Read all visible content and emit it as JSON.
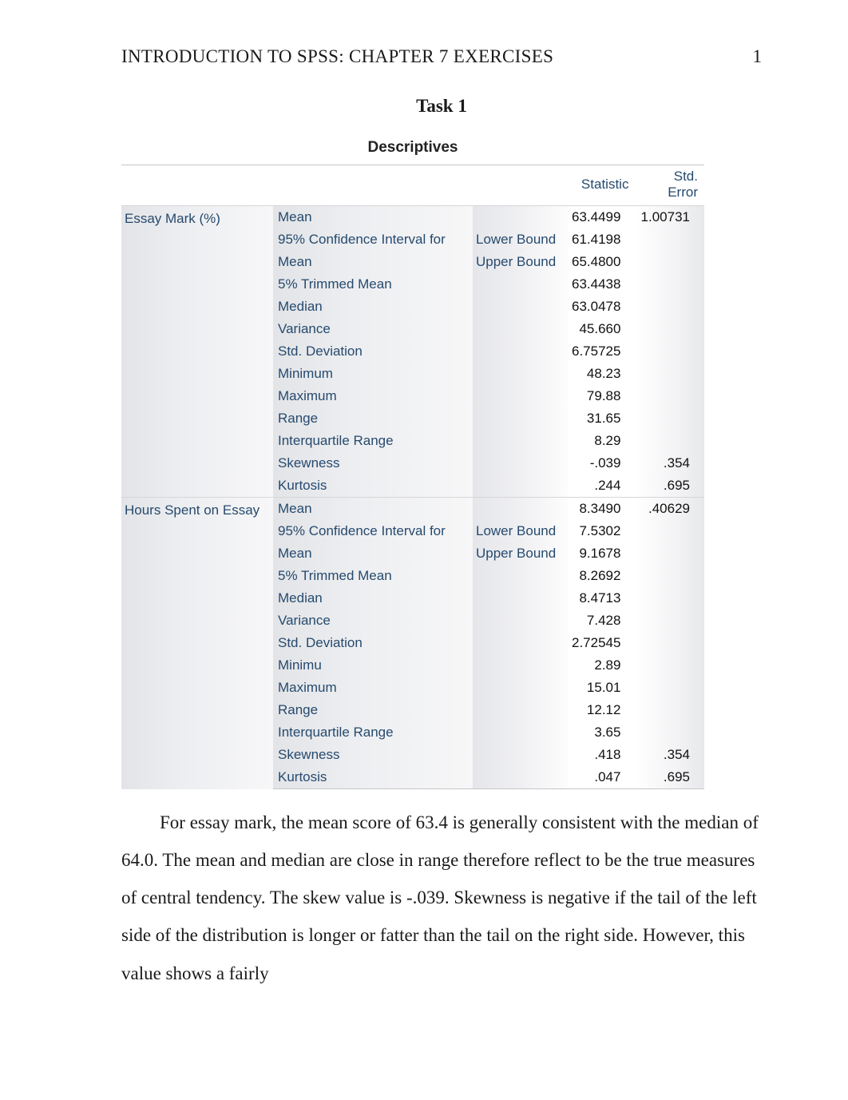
{
  "header": {
    "running_head": "INTRODUCTION TO SPSS: CHAPTER 7 EXERCISES",
    "page_number": "1"
  },
  "task_title": "Task 1",
  "table": {
    "title": "Descriptives",
    "col_statistic": "Statistic",
    "col_stderror": "Std. Error",
    "groups": [
      {
        "variable": "Essay Mark (%)",
        "rows": [
          {
            "label": "Mean",
            "bound": "",
            "stat": "63.4499",
            "se": "1.00731"
          },
          {
            "label": "95% Confidence Interval for",
            "bound": "Lower Bound",
            "stat": "61.4198",
            "se": ""
          },
          {
            "label": "Mean",
            "bound": "Upper Bound",
            "stat": "65.4800",
            "se": ""
          },
          {
            "label": "5% Trimmed Mean",
            "bound": "",
            "stat": "63.4438",
            "se": ""
          },
          {
            "label": "Median",
            "bound": "",
            "stat": "63.0478",
            "se": ""
          },
          {
            "label": "Variance",
            "bound": "",
            "stat": "45.660",
            "se": ""
          },
          {
            "label": "Std. Deviation",
            "bound": "",
            "stat": "6.75725",
            "se": ""
          },
          {
            "label": "Minimum",
            "bound": "",
            "stat": "48.23",
            "se": ""
          },
          {
            "label": "Maximum",
            "bound": "",
            "stat": "79.88",
            "se": ""
          },
          {
            "label": "Range",
            "bound": "",
            "stat": "31.65",
            "se": ""
          },
          {
            "label": "Interquartile Range",
            "bound": "",
            "stat": "8.29",
            "se": ""
          },
          {
            "label": "Skewness",
            "bound": "",
            "stat": "-.039",
            "se": ".354"
          },
          {
            "label": "Kurtosis",
            "bound": "",
            "stat": ".244",
            "se": ".695"
          }
        ]
      },
      {
        "variable": "Hours Spent on Essay",
        "rows": [
          {
            "label": "Mean",
            "bound": "",
            "stat": "8.3490",
            "se": ".40629"
          },
          {
            "label": "95% Confidence Interval for",
            "bound": "Lower Bound",
            "stat": "7.5302",
            "se": ""
          },
          {
            "label": "Mean",
            "bound": "Upper Bound",
            "stat": "9.1678",
            "se": ""
          },
          {
            "label": "5% Trimmed Mean",
            "bound": "",
            "stat": "8.2692",
            "se": ""
          },
          {
            "label": "Median",
            "bound": "",
            "stat": "8.4713",
            "se": ""
          },
          {
            "label": "Variance",
            "bound": "",
            "stat": "7.428",
            "se": ""
          },
          {
            "label": "Std. Deviation",
            "bound": "",
            "stat": "2.72545",
            "se": ""
          },
          {
            "label": "Minimu",
            "bound": "",
            "stat": "2.89",
            "se": ""
          },
          {
            "label": "Maximum",
            "bound": "",
            "stat": "15.01",
            "se": ""
          },
          {
            "label": "Range",
            "bound": "",
            "stat": "12.12",
            "se": ""
          },
          {
            "label": "Interquartile Range",
            "bound": "",
            "stat": "3.65",
            "se": ""
          },
          {
            "label": "Skewness",
            "bound": "",
            "stat": ".418",
            "se": ".354"
          },
          {
            "label": "Kurtosis",
            "bound": "",
            "stat": ".047",
            "se": ".695"
          }
        ]
      }
    ]
  },
  "paragraph": "For essay mark, the mean score of 63.4 is generally consistent with the median of 64.0. The mean and median are close in range therefore reflect to be the true measures of central tendency. The skew value is -.039. Skewness is negative if the tail of the left side of the distribution is longer or fatter than the tail on the right side. However, this value shows a fairly"
}
